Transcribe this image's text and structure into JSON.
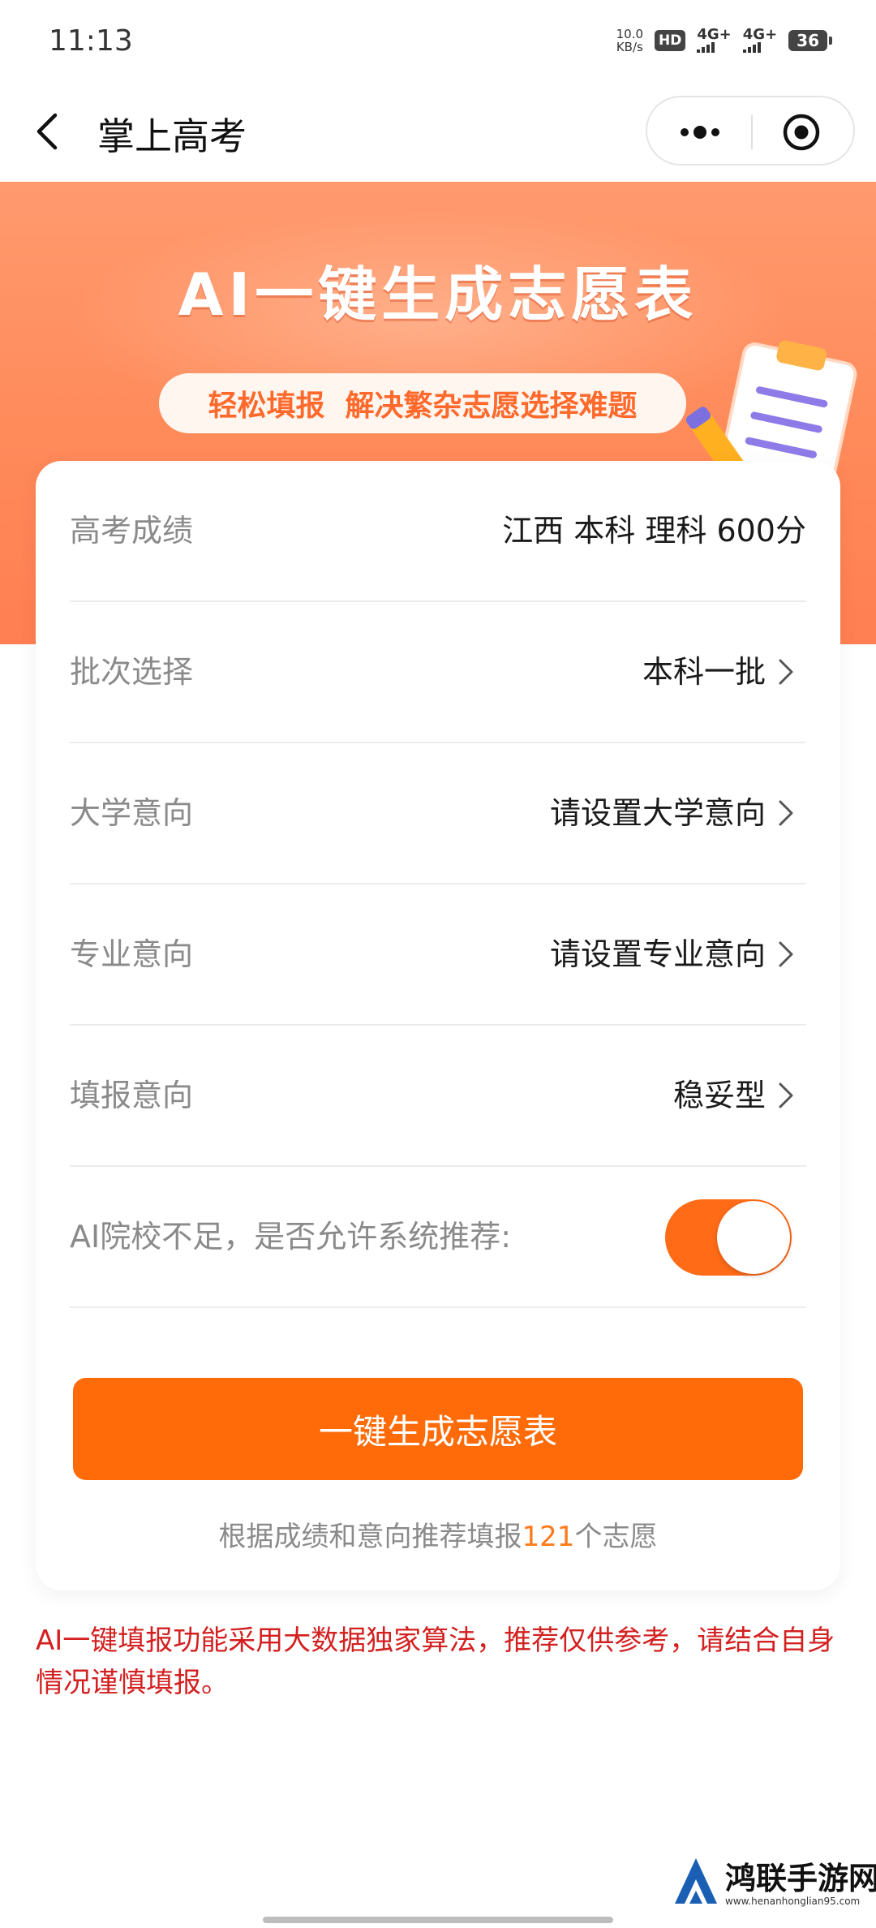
{
  "status_bar": {
    "time": "11:13",
    "net_speed_value": "10.0",
    "net_speed_unit": "KB/s",
    "hd": "HD",
    "sim1": "4G+",
    "sim2": "4G+",
    "battery": "36"
  },
  "nav": {
    "title": "掌上高考",
    "back_icon": "chevron-left-icon",
    "more_icon": "more-dots-icon",
    "close_icon": "target-circle-icon"
  },
  "banner": {
    "title": "AI一键生成志愿表",
    "subtitle": "轻松填报  解决繁杂志愿选择难题",
    "illustration": "clipboard-pencil-illustration"
  },
  "form": {
    "rows": [
      {
        "label": "高考成绩",
        "value": "江西 本科 理科 600分"
      },
      {
        "label": "批次选择",
        "value": "本科一批"
      },
      {
        "label": "大学意向",
        "value": "请设置大学意向"
      },
      {
        "label": "专业意向",
        "value": "请设置专业意向"
      },
      {
        "label": "填报意向",
        "value": "稳妥型"
      }
    ],
    "toggle_label": "AI院校不足，是否允许系统推荐:",
    "toggle_on": true,
    "button_label": "一键生成志愿表",
    "hint_prefix": "根据成绩和意向推荐填报",
    "hint_count": "121",
    "hint_suffix": "个志愿"
  },
  "disclaimer": "AI一键填报功能采用大数据独家算法，推荐仅供参考，请结合自身情况谨慎填报。",
  "watermark": {
    "name": "鸿联手游网",
    "url": "www.henanhonglian95.com"
  },
  "colors": {
    "accent": "#ff6b08",
    "banner": "#ff8a5a",
    "disclaimer": "#d32020",
    "hint_count": "#ff7a1a"
  }
}
